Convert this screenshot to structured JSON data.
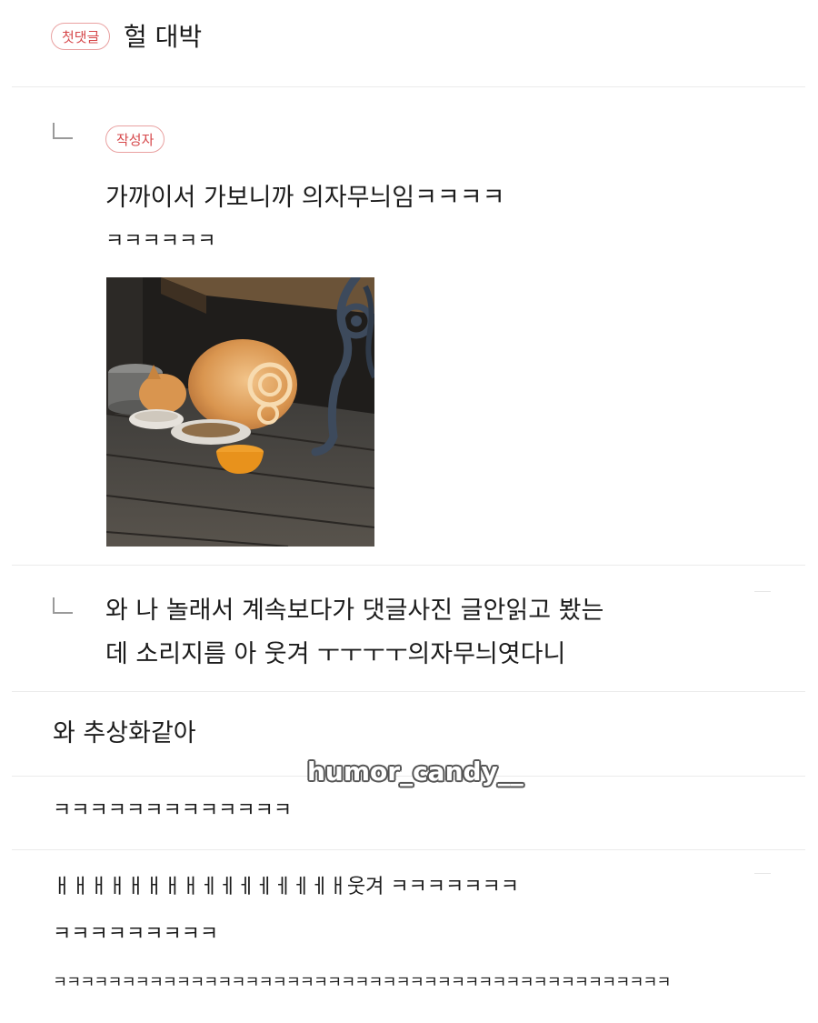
{
  "comments": [
    {
      "badge": "첫댓글",
      "lines": [
        "헐 대박"
      ]
    },
    {
      "badge": "작성자",
      "lines": [
        "가까이서 가보니까 의자무늬임ㅋㅋㅋㅋ",
        "ㅋㅋㅋㅋㅋㅋ"
      ],
      "image_alt": "cat-eating-under-bench-photo"
    },
    {
      "lines": [
        "와 나 놀래서 계속보다가 댓글사진 글안읽고 봤는",
        "데 소리지름 아 웃겨 ㅜㅜㅜㅜ의자무늬엿다니"
      ]
    },
    {
      "lines": [
        "와 추상화같아"
      ]
    },
    {
      "lines": [
        "ㅋㅋㅋㅋㅋㅋㅋㅋㅋㅋㅋㅋㅋ"
      ]
    },
    {
      "lines": [
        "ㅐㅐㅐㅐㅐㅐㅐㅐㅔㅔㅔㅔㅔㅔㅔㅐ웃겨 ㅋㅋㅋㅋㅋㅋㅋ",
        "ㅋㅋㅋㅋㅋㅋㅋㅋㅋ",
        "ㅋㅋㅋㅋㅋㅋㅋㅋㅋㅋㅋㅋㅋㅋㅋㅋㅋㅋㅋㅋㅋㅋㅋㅋㅋㅋㅋㅋㅋㅋㅋㅋㅋㅋㅋㅋㅋㅋㅋㅋㅋㅋㅋㅋㅋ"
      ]
    }
  ],
  "watermark": "humor_candy__",
  "colors": {
    "badge_text": "#d6484b",
    "badge_border": "#e9a1a1",
    "divider": "#ebebeb",
    "text": "#1c1c1c"
  }
}
